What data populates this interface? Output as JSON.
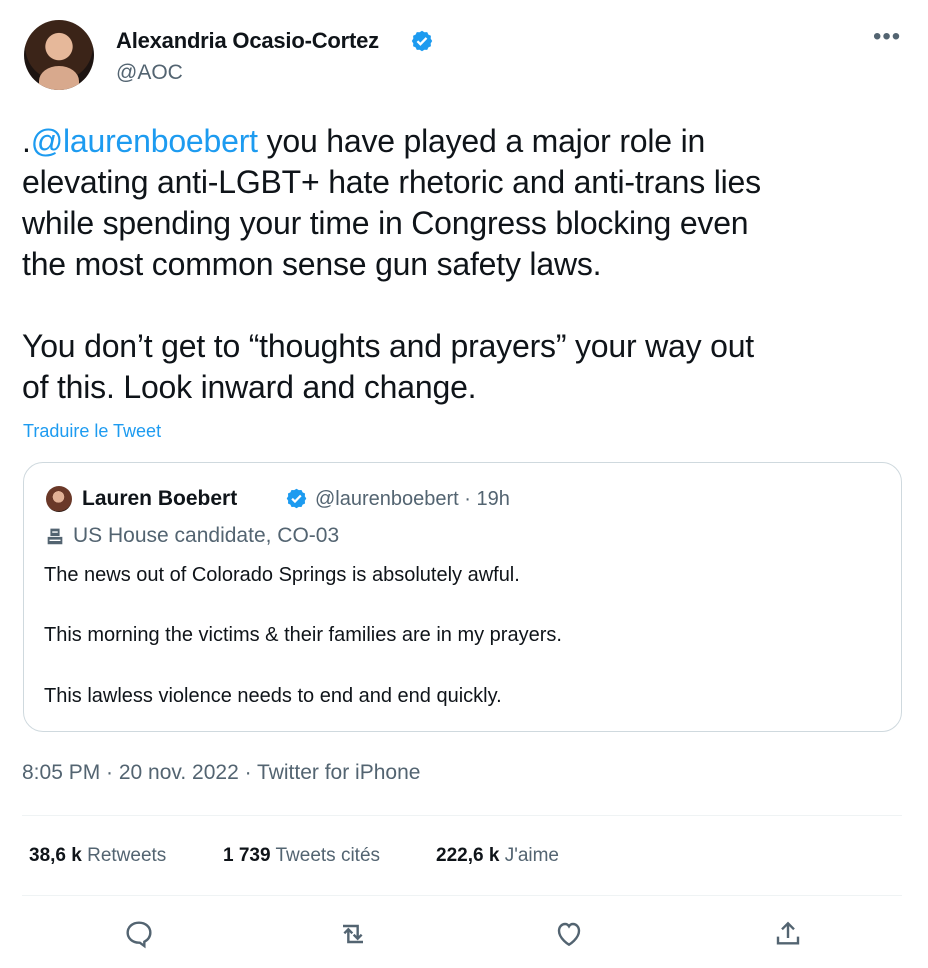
{
  "author": {
    "name": "Alexandria Ocasio-Cortez",
    "handle": "@AOC"
  },
  "tweet": {
    "mention": "@laurenboebert",
    "text_before_mention": ".",
    "text_after_mention": " you have played a major role in\nelevating anti-LGBT+ hate rhetoric and anti-trans lies\nwhile spending your time in Congress blocking even\nthe most common sense gun safety laws.\n\nYou don’t get to “thoughts and prayers” your way out\nof this. Look inward and change.",
    "translate_label": "Traduire le Tweet"
  },
  "quoted_tweet": {
    "name": "Lauren Boebert",
    "handle_time": "@laurenboebert · 19h",
    "label": "US House candidate, CO-03",
    "lines": [
      "The news out of Colorado Springs is absolutely awful.",
      "This morning the victims & their families are in my prayers.",
      "This lawless violence needs to end and end quickly."
    ]
  },
  "meta": {
    "timestamp": "8:05 PM · 20 nov. 2022 · Twitter for iPhone"
  },
  "stats": {
    "retweets": {
      "count": "38,6 k",
      "label": "Retweets"
    },
    "quotes": {
      "count": "1 739",
      "label": "Tweets cités"
    },
    "likes": {
      "count": "222,6 k",
      "label": "J'aime"
    }
  },
  "icons": {
    "more": "more-icon",
    "verified": "verified-badge-icon",
    "candidate": "ballot-box-icon",
    "reply": "reply-icon",
    "retweet": "retweet-icon",
    "like": "heart-icon",
    "share": "share-icon"
  },
  "colors": {
    "accent": "#1d9bf0",
    "secondary_text": "#536471",
    "border": "#cfd9de"
  }
}
